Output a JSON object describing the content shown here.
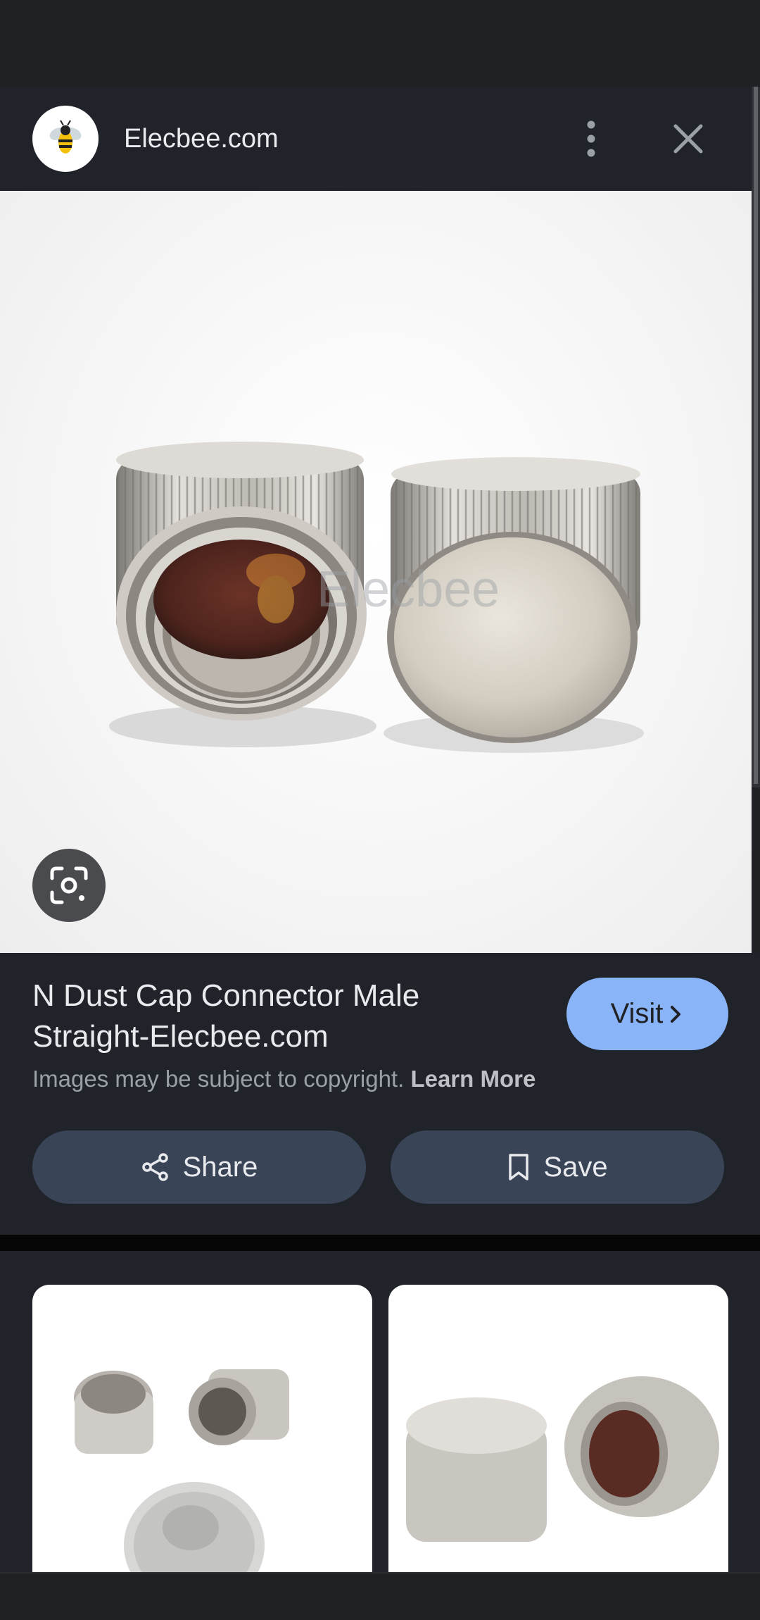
{
  "header": {
    "site_name": "Elecbee.com",
    "icons": {
      "logo": "bee-logo-icon",
      "more": "more-vert-icon",
      "close": "close-icon"
    }
  },
  "image": {
    "subject": "two nickel knurled N connector dust caps",
    "watermark_icon": "bee-watermark"
  },
  "lens": {
    "icon": "google-lens-icon"
  },
  "info": {
    "title": "N Dust Cap Connector Male Straight-Elecbee.com",
    "copyright_text": "Images may be subject to copyright.",
    "learn_more": "Learn More",
    "visit_label": "Visit",
    "share_label": "Share",
    "save_label": "Save"
  },
  "related": {
    "items": [
      {
        "icon": "related-image-thumbnail"
      },
      {
        "icon": "related-image-thumbnail"
      }
    ]
  },
  "colors": {
    "background": "#202124",
    "panel": "#20232a",
    "accent": "#8ab4f8",
    "button_fill": "#394457",
    "text_primary": "#e8eaed",
    "text_secondary": "#9aa0a6"
  }
}
